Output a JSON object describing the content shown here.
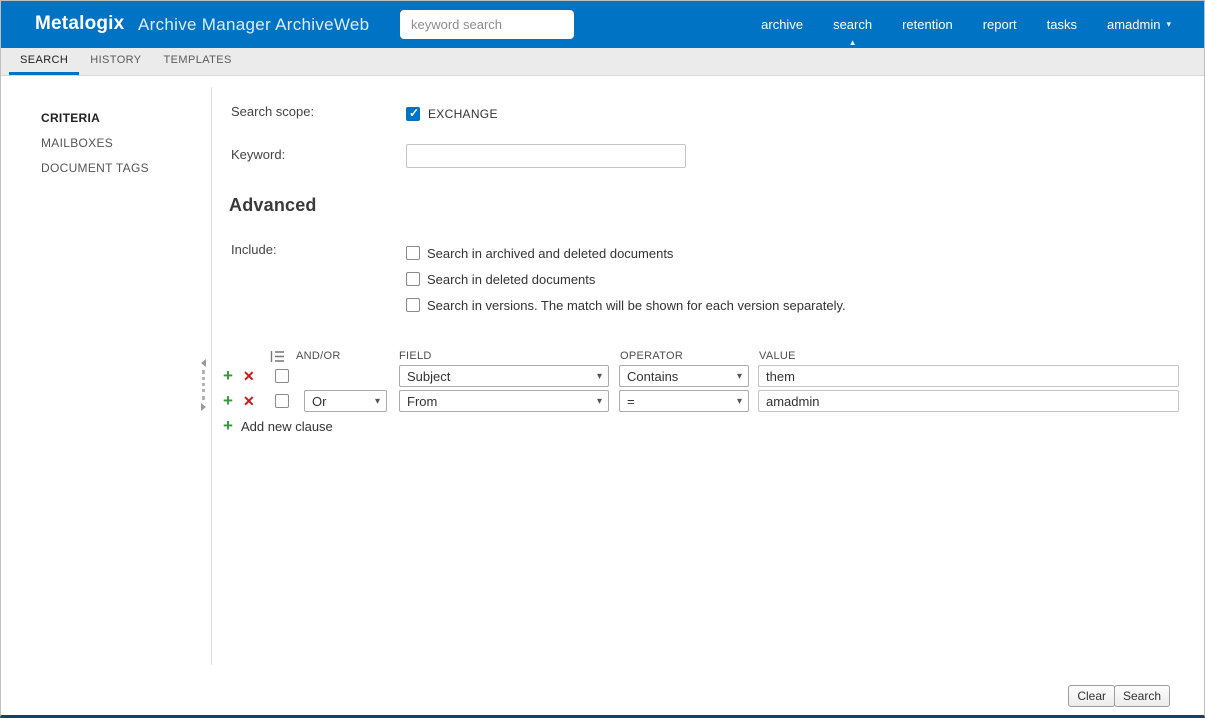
{
  "colors": {
    "header_blue": "#0073c5",
    "accent_blue": "#0073c5",
    "add_green": "#2f9b38",
    "remove_red": "#cf1717",
    "bottom_bar_navy": "#1b3d66"
  },
  "icons": {
    "caret_down": "▾",
    "caret_up": "▲",
    "plus": "+",
    "remove": "✕"
  },
  "header": {
    "brand": "Metalogix",
    "app_title": "Archive Manager ArchiveWeb",
    "search": {
      "placeholder": "keyword search",
      "value": ""
    },
    "nav": [
      {
        "label": "archive",
        "active": false
      },
      {
        "label": "search",
        "active": true
      },
      {
        "label": "retention",
        "active": false
      },
      {
        "label": "report",
        "active": false
      },
      {
        "label": "tasks",
        "active": false
      }
    ],
    "user_menu": "amadmin"
  },
  "tabbar": {
    "tabs": [
      {
        "label": "SEARCH",
        "active": true
      },
      {
        "label": "HISTORY",
        "active": false
      },
      {
        "label": "TEMPLATES",
        "active": false
      }
    ]
  },
  "sidebar": {
    "items": [
      {
        "label": "CRITERIA",
        "active": true
      },
      {
        "label": "MAILBOXES",
        "active": false
      },
      {
        "label": "DOCUMENT TAGS",
        "active": false
      }
    ]
  },
  "criteria": {
    "scope_label": "Search scope:",
    "scope_option": {
      "label": "EXCHANGE",
      "checked": true
    },
    "keyword_label": "Keyword:",
    "keyword_value": "",
    "advanced_heading": "Advanced",
    "include_label": "Include:",
    "include_options": [
      {
        "label": "Search in archived and deleted documents",
        "checked": false
      },
      {
        "label": "Search in deleted documents",
        "checked": false
      },
      {
        "label": "Search in versions. The match will be shown for each version separately.",
        "checked": false
      }
    ]
  },
  "clause_builder": {
    "headers": {
      "andor": "AND/OR",
      "field": "FIELD",
      "operator": "OPERATOR",
      "value": "VALUE"
    },
    "rows": [
      {
        "andor": null,
        "field": "Subject",
        "operator": "Contains",
        "value": "them",
        "checked": false
      },
      {
        "andor": "Or",
        "field": "From",
        "operator": "=",
        "value": "amadmin",
        "checked": false
      }
    ],
    "add_new_label": "Add new clause"
  },
  "footer": {
    "clear": "Clear",
    "search": "Search"
  }
}
